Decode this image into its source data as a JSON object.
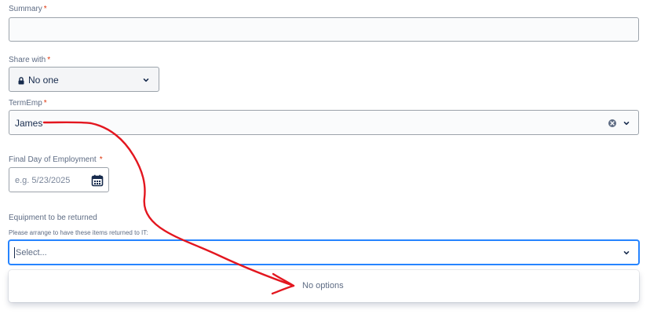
{
  "summary": {
    "label": "Summary",
    "required_mark": "*",
    "value": ""
  },
  "share_with": {
    "label": "Share with",
    "required_mark": "*",
    "value": "No one",
    "icon": "lock-icon"
  },
  "term_emp": {
    "label": "TermEmp",
    "required_mark": "*",
    "value": "James",
    "clear_icon": "clear-icon"
  },
  "final_day": {
    "label": "Final Day of Employment",
    "required_mark": "*",
    "placeholder": "e.g. 5/23/2025",
    "icon": "calendar-icon"
  },
  "equipment": {
    "label": "Equipment to be returned",
    "helper": "Please arrange to have these items returned to IT:",
    "placeholder": "Select...",
    "menu_text": "No options"
  },
  "colors": {
    "required": "#de350b",
    "focus": "#2684ff",
    "annotation": "#e3161f"
  }
}
